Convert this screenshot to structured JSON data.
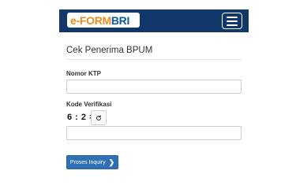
{
  "brand": {
    "logo_prefix": "e-FORM",
    "logo_suffix": "BRI"
  },
  "nav": {
    "menu_icon": "hamburger-icon"
  },
  "form": {
    "title": "Cek Penerima BPUM",
    "ktp_label": "Nomor KTP",
    "ktp_value": "",
    "verification_label": "Kode Verifikasi",
    "captcha_text": "6 : 2 =",
    "refresh_icon": "refresh-icon",
    "verification_value": "",
    "submit_label": "Proses Inquiry",
    "submit_icon": "chevron-right-icon"
  },
  "colors": {
    "navbar": "#12386b",
    "logo_orange": "#f08a1c",
    "logo_blue": "#0a5aa8",
    "primary_button": "#2f6fb4"
  }
}
